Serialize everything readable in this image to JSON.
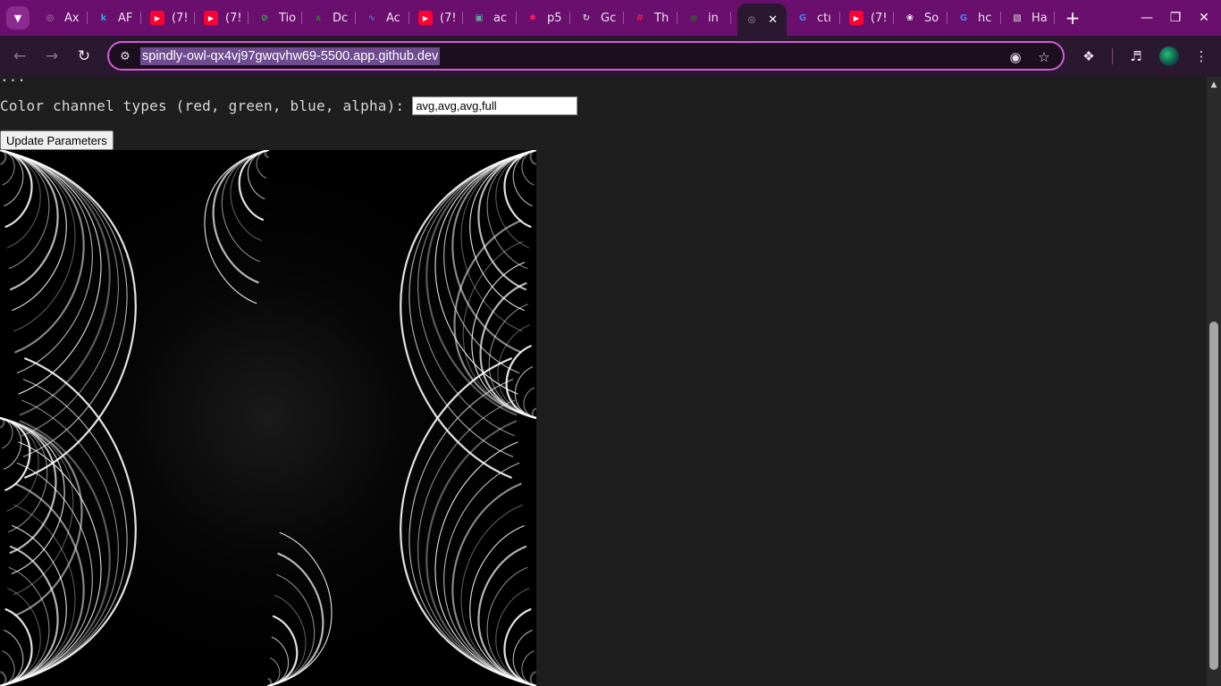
{
  "browser": {
    "tabs": [
      {
        "label": "Ax",
        "icon": "globe-icon",
        "color": "#9e9e9e"
      },
      {
        "label": "AF",
        "icon": "k-icon",
        "color": "#2aa7df"
      },
      {
        "label": "(7!",
        "icon": "youtube-icon",
        "color": "#ff0033"
      },
      {
        "label": "(7!",
        "icon": "youtube-icon",
        "color": "#ff0033"
      },
      {
        "label": "Tio",
        "icon": "tio-icon",
        "color": "#3aa655"
      },
      {
        "label": "Dc",
        "icon": "chart-icon",
        "color": "#2e7d32"
      },
      {
        "label": "Ac",
        "icon": "waveform-icon",
        "color": "#4a7bd8"
      },
      {
        "label": "(7!",
        "icon": "youtube-icon",
        "color": "#ff0033"
      },
      {
        "label": "ac",
        "icon": "map-icon",
        "color": "#5fa8a0"
      },
      {
        "label": "p5",
        "icon": "asterisk-icon",
        "color": "#ed225d"
      },
      {
        "label": "Gc",
        "icon": "refresh-icon",
        "color": "#cfcfcf"
      },
      {
        "label": "Th",
        "icon": "slack-icon",
        "color": "#e01e5a"
      },
      {
        "label": "in",
        "icon": "github-icon",
        "color": "#444444"
      },
      {
        "label": "",
        "icon": "globe-icon",
        "color": "#9e9e9e",
        "active": true
      },
      {
        "label": "ctı",
        "icon": "google-icon",
        "color": "#4285f4"
      },
      {
        "label": "(7!",
        "icon": "youtube-icon",
        "color": "#ff0033"
      },
      {
        "label": "So",
        "icon": "openai-icon",
        "color": "#ffffff"
      },
      {
        "label": "hc",
        "icon": "google-icon",
        "color": "#4285f4"
      },
      {
        "label": "Ha",
        "icon": "image-icon",
        "color": "#dddddd"
      }
    ],
    "url": "spindly-owl-qx4vj97gwqvhw69-5500.app.github.dev",
    "colors": {
      "frame": "#6a0f6e",
      "toolbar": "#2a1830",
      "accent": "#d55ad9"
    }
  },
  "page": {
    "cut_off_text": "...",
    "color_channel_label": "Color channel types (red, green, blue, alpha):",
    "color_channel_value": "avg,avg,avg,full",
    "update_button": "Update Parameters",
    "fractal_canvas": "fractal-canvas"
  }
}
